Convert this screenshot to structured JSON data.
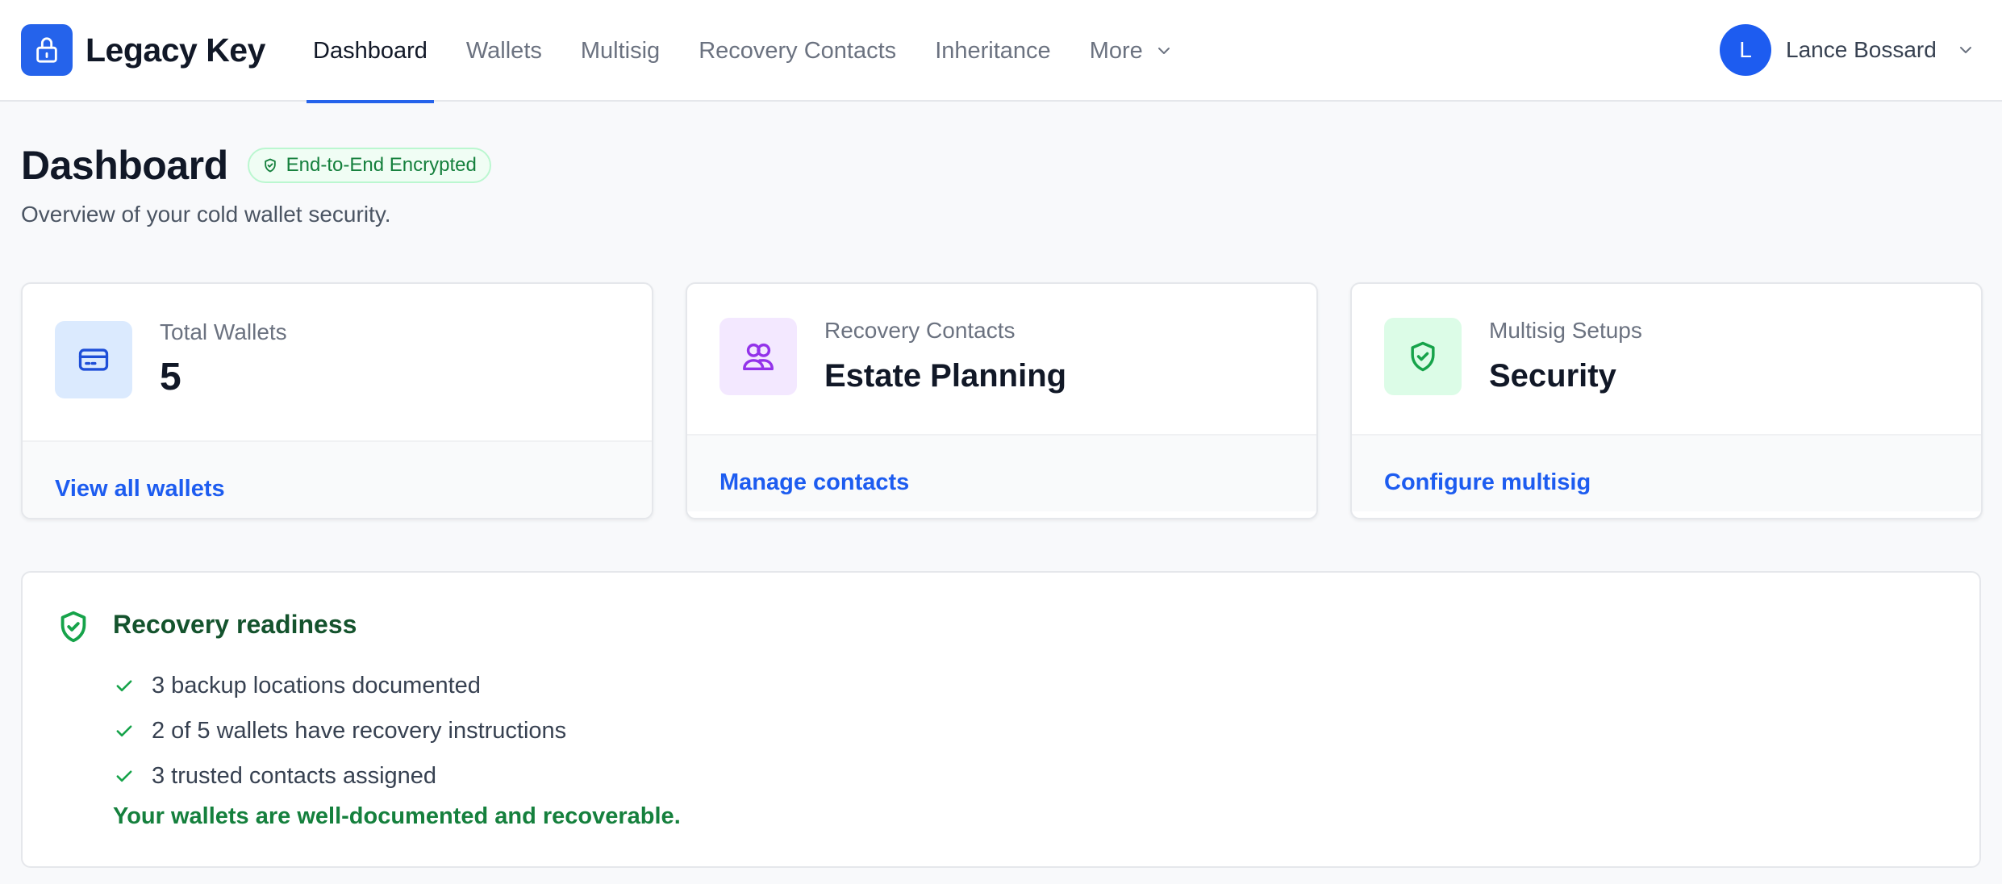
{
  "app": {
    "name": "Legacy Key",
    "brand_color": "#2563eb"
  },
  "nav": {
    "items": [
      {
        "label": "Dashboard",
        "active": true
      },
      {
        "label": "Wallets"
      },
      {
        "label": "Multisig"
      },
      {
        "label": "Recovery Contacts"
      },
      {
        "label": "Inheritance"
      },
      {
        "label": "More",
        "icon": "chevron-down-icon"
      }
    ]
  },
  "user": {
    "initial": "L",
    "name": "Lance Bossard"
  },
  "header": {
    "title": "Dashboard",
    "badge": "End-to-End Encrypted",
    "subtitle": "Overview of your cold wallet security."
  },
  "cards": [
    {
      "icon": "credit-card-icon",
      "label": "Total Wallets",
      "value": "5",
      "link": "View all wallets",
      "icon_bg": "#dbeafe",
      "icon_color": "#1d4ed8"
    },
    {
      "icon": "users-icon",
      "label": "Recovery Contacts",
      "value": "Estate Planning",
      "link": "Manage contacts",
      "icon_bg": "#f3e8ff",
      "icon_color": "#9333ea"
    },
    {
      "icon": "shield-check-icon",
      "label": "Multisig Setups",
      "value": "Security",
      "link": "Configure multisig",
      "icon_bg": "#dcfce7",
      "icon_color": "#16a34a"
    }
  ],
  "readiness": {
    "title": "Recovery readiness",
    "items": [
      "3 backup locations documented",
      "2 of 5 wallets have recovery instructions",
      "3 trusted contacts assigned"
    ],
    "status": "Your wallets are well-documented and recoverable."
  }
}
